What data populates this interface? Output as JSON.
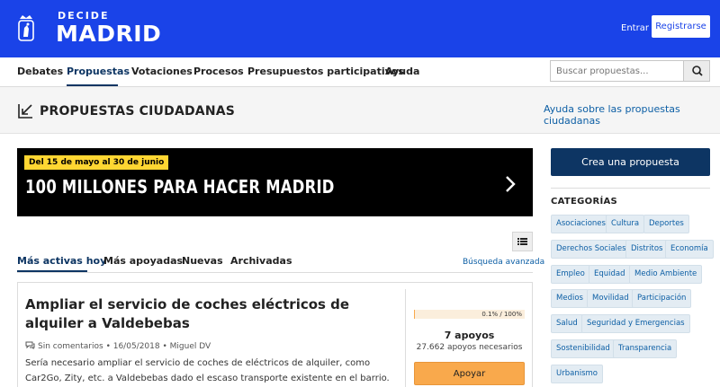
{
  "header": {
    "brand_top": "DECIDE",
    "brand_main": "MADRID",
    "login_label": "Entrar",
    "register_label": "Registrarse",
    "background_color": "#1a43e8"
  },
  "nav": {
    "items": [
      "Debates",
      "Propuestas",
      "Votaciones",
      "Procesos",
      "Presupuestos participativos",
      "Ayuda"
    ],
    "active": "Propuestas",
    "search_placeholder": "Buscar propuestas..."
  },
  "page": {
    "title": "PROPUESTAS CIUDADANAS",
    "help_link": "Ayuda sobre las propuestas ciudadanas"
  },
  "banner": {
    "date_label": "Del 15 de mayo al 30 de junio",
    "title": "100 MILLONES PARA HACER MADRID",
    "date_color": "#ffd632"
  },
  "tabs": {
    "items": [
      "Más activas hoy",
      "Más apoyadas",
      "Nuevas",
      "Archivadas"
    ],
    "active": "Más activas hoy",
    "advanced_search": "Búsqueda avanzada"
  },
  "proposal": {
    "title": "Ampliar el servicio de coches eléctricos de alquiler a Valdebebas",
    "comments": "Sin comentarios",
    "date": "16/05/2018",
    "author": "Miguel DV",
    "description": "Sería necesario ampliar el servicio de coches de eléctricos de alquiler, como Car2Go, Zity, etc. a Valdebebas dado el escaso transporte existente en el barrio.",
    "progress_label": "0.1% / 100%",
    "progress_percent": 0.1,
    "supports": "7 apoyos",
    "needed": "27.662 apoyos necesarios",
    "support_button": "Apoyar",
    "accent_color": "#f9a94c"
  },
  "sidebar": {
    "create_button": "Crea una propuesta",
    "categories_title": "CATEGORÍAS",
    "categories": [
      "Asociaciones",
      "Cultura",
      "Deportes",
      "Derechos Sociales",
      "Distritos",
      "Economía",
      "Empleo",
      "Equidad",
      "Medio Ambiente",
      "Medios",
      "Movilidad",
      "Participación",
      "Salud",
      "Seguridad y Emergencias",
      "Sostenibilidad",
      "Transparencia",
      "Urbanismo"
    ],
    "primary_color": "#0d3563"
  }
}
